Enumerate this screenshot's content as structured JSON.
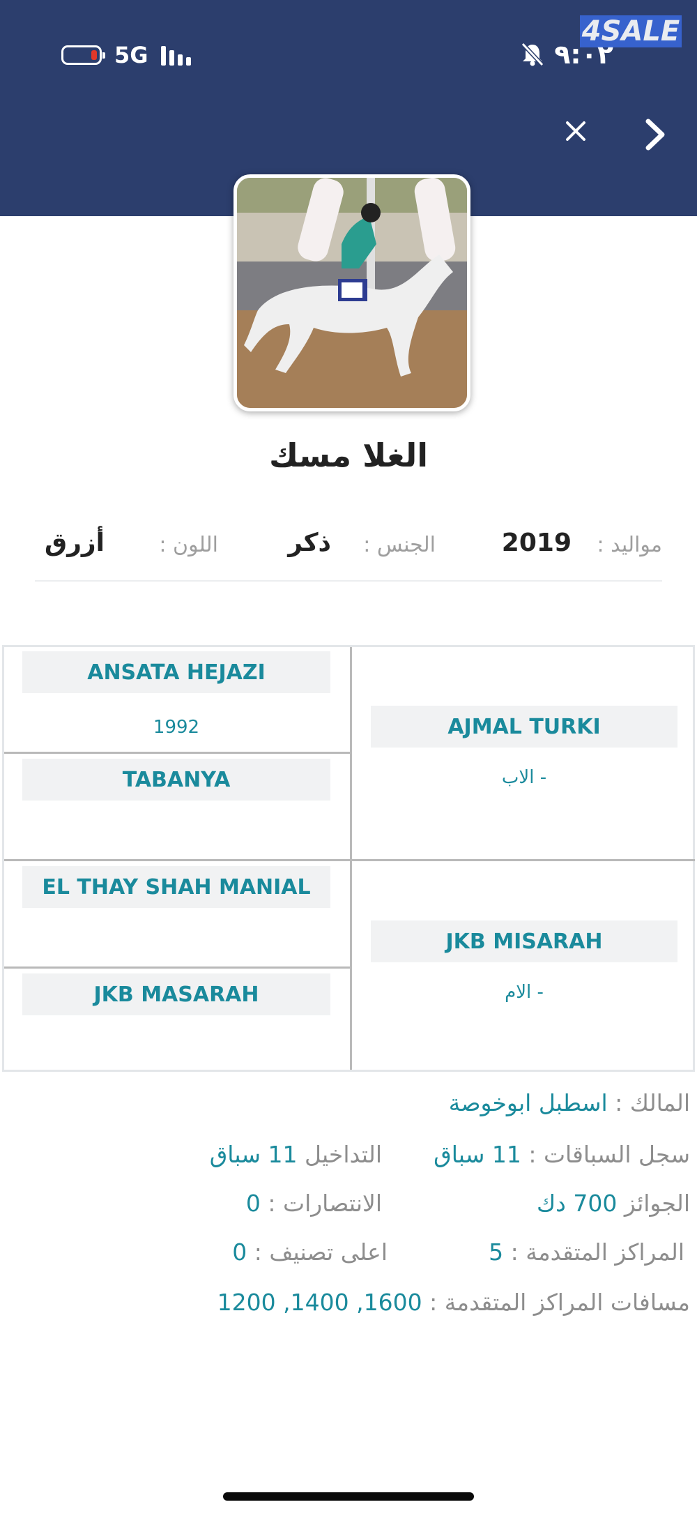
{
  "status_bar": {
    "network": "5G",
    "time": "٩:٠٢",
    "brand": "4SALE"
  },
  "header": {
    "close_icon": "close-icon",
    "back_icon": "chevron-right-icon"
  },
  "horse": {
    "name": "الغلا مسك",
    "birth_label": "مواليد :",
    "birth_value": "2019",
    "gender_label": "الجنس :",
    "gender_value": "ذكر",
    "color_label": "اللون :",
    "color_value": "أزرق"
  },
  "pedigree": {
    "sire": {
      "name": "AJMAL TURKI",
      "relation": "الاب -"
    },
    "dam": {
      "name": "JKB MISARAH",
      "relation": "الام -"
    },
    "sire_sire": {
      "name": "ANSATA HEJAZI",
      "year": "1992"
    },
    "sire_dam": {
      "name": "TABANYA"
    },
    "dam_sire": {
      "name": "EL THAY SHAH MANIAL"
    },
    "dam_dam": {
      "name": "JKB MASARAH"
    }
  },
  "stats": {
    "owner_label": "المالك :",
    "owner_value": "اسطبل ابوخوصة",
    "races_label": "سجل السباقات :",
    "races_value": "11 سباق",
    "entries_label": "التداخيل",
    "entries_value": "11 سباق",
    "prizes_label": "الجوائز",
    "prizes_value": "700 دك",
    "wins_label": "الانتصارات :",
    "wins_value": "0",
    "top_places_label": "المراكز المتقدمة :",
    "top_places_value": "5",
    "best_rank_label": "اعلى تصنيف :",
    "best_rank_value": "0",
    "distances_label": "مسافات المراكز المتقدمة :",
    "distances_value": "1600, 1400, 1200"
  },
  "colors": {
    "header": "#2c3e6d",
    "accent": "#1a8a9c"
  }
}
